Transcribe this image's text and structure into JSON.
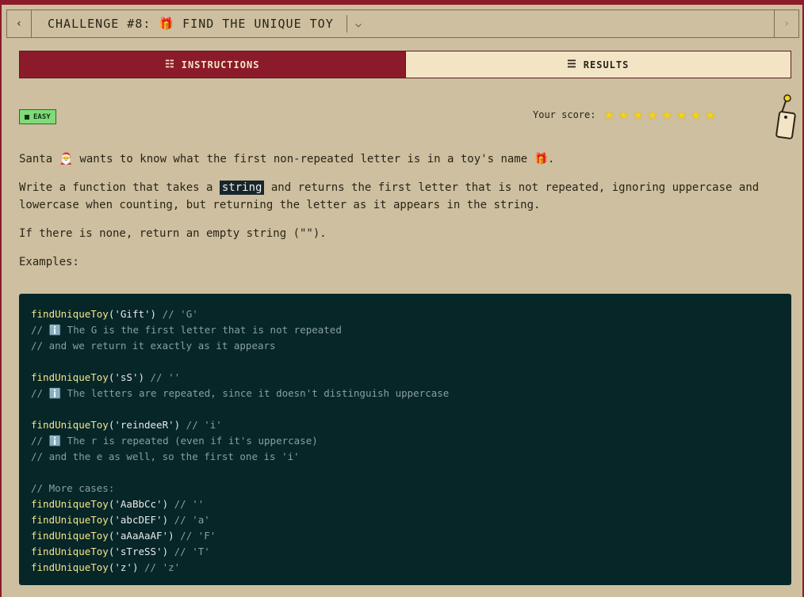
{
  "titlebar": {
    "title": "CHALLENGE #8: 🎁 FIND THE UNIQUE TOY",
    "back_icon": "chevron-left-icon",
    "next_icon": "chevron-right-icon",
    "menu_icon": "chevron-down-icon"
  },
  "tabs": [
    {
      "label": "INSTRUCTIONS",
      "icon": "document-icon",
      "active": true
    },
    {
      "label": "RESULTS",
      "icon": "checklist-icon",
      "active": false
    }
  ],
  "difficulty": "EASY",
  "score": {
    "label": "Your score:",
    "stars": 8,
    "star_color": "#f5d21f"
  },
  "instructions": {
    "p1": "Santa 🎅 wants to know what the first non-repeated letter is in a toy's name 🎁.",
    "p2_before": "Write a function that takes a ",
    "p2_highlight": "string",
    "p2_after": " and returns the first letter that is not repeated, ignoring uppercase and lowercase when counting, but returning the letter as it appears in the string.",
    "p3": "If there is none, return an empty string (\"\").",
    "p4": "Examples:"
  },
  "code_lines": [
    {
      "type": "call",
      "fn": "findUniqueToy",
      "arg": "('Gift')",
      "comment": " // 'G'"
    },
    {
      "type": "comment",
      "text": "// ℹ️ The G is the first letter that is not repeated"
    },
    {
      "type": "comment",
      "text": "// and we return it exactly as it appears"
    },
    {
      "type": "blank"
    },
    {
      "type": "call",
      "fn": "findUniqueToy",
      "arg": "('sS')",
      "comment": " // ''"
    },
    {
      "type": "comment",
      "text": "// ℹ️ The letters are repeated, since it doesn't distinguish uppercase"
    },
    {
      "type": "blank"
    },
    {
      "type": "call",
      "fn": "findUniqueToy",
      "arg": "('reindeeR')",
      "comment": " // 'i'"
    },
    {
      "type": "comment",
      "text": "// ℹ️ The r is repeated (even if it's uppercase)"
    },
    {
      "type": "comment",
      "text": "// and the e as well, so the first one is 'i'"
    },
    {
      "type": "blank"
    },
    {
      "type": "comment",
      "text": "// More cases:"
    },
    {
      "type": "call",
      "fn": "findUniqueToy",
      "arg": "('AaBbCc')",
      "comment": " // ''"
    },
    {
      "type": "call",
      "fn": "findUniqueToy",
      "arg": "('abcDEF')",
      "comment": " // 'a'"
    },
    {
      "type": "call",
      "fn": "findUniqueToy",
      "arg": "('aAaAaAF')",
      "comment": " // 'F'"
    },
    {
      "type": "call",
      "fn": "findUniqueToy",
      "arg": "('sTreSS')",
      "comment": " // 'T'"
    },
    {
      "type": "call",
      "fn": "findUniqueToy",
      "arg": "('z')",
      "comment": " // 'z'"
    }
  ],
  "colors": {
    "accent": "#8b1b2a",
    "background": "#cdbf9f",
    "code_bg": "#062628",
    "easy_badge": "#7fdb79"
  }
}
